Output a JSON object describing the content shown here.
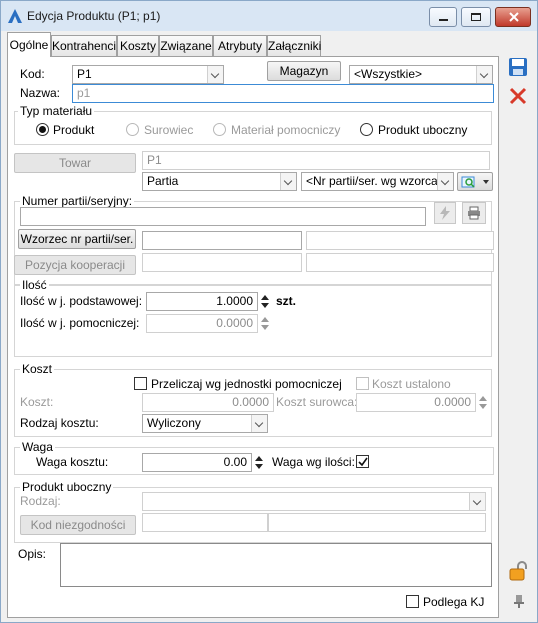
{
  "window": {
    "title": "Edycja Produktu (P1; p1)"
  },
  "tabs": [
    "Ogólne",
    "Kontrahenci",
    "Koszty",
    "Związane",
    "Atrybuty",
    "Załączniki"
  ],
  "general": {
    "kod_label": "Kod:",
    "kod_value": "P1",
    "magazyn_button": "Magazyn",
    "magazyn_value": "<Wszystkie>",
    "nazwa_label": "Nazwa:",
    "nazwa_value": "p1"
  },
  "material_type": {
    "title": "Typ materiału",
    "options": [
      "Produkt",
      "Surowiec",
      "Materiał pomocniczy",
      "Produkt uboczny"
    ],
    "selected": "Produkt"
  },
  "towar": {
    "button": "Towar",
    "value": "P1",
    "partia_value": "Partia",
    "nr_partii_value": "<Nr partii/ser. wg wzorca>"
  },
  "batch": {
    "title": "Numer partii/seryjny:",
    "wzorzec_button": "Wzorzec nr partii/ser.",
    "kooperacja_button": "Pozycja kooperacji"
  },
  "quantity": {
    "title": "Ilość",
    "base_label": "Ilość w j. podstawowej:",
    "base_value": "1.0000",
    "base_unit": "szt.",
    "aux_label": "Ilość w j. pomocniczej:",
    "aux_value": "0.0000"
  },
  "cost": {
    "title": "Koszt",
    "przeliczaj_label": "Przeliczaj wg jednostki pomocniczej",
    "ustalono_label": "Koszt ustalono",
    "koszt_label": "Koszt:",
    "koszt_value": "0.0000",
    "surowca_label": "Koszt surowca:",
    "surowca_value": "0.0000",
    "rodzaj_label": "Rodzaj kosztu:",
    "rodzaj_value": "Wyliczony"
  },
  "weight": {
    "title": "Waga",
    "label": "Waga kosztu:",
    "value": "0.00",
    "wg_ilosci_label": "Waga wg ilości:",
    "wg_ilosci_checked": true
  },
  "byproduct": {
    "title": "Produkt uboczny",
    "rodzaj_label": "Rodzaj:",
    "kod_button": "Kod niezgodności"
  },
  "opis": {
    "label": "Opis:",
    "value": ""
  },
  "footer": {
    "podlega_label": "Podlega KJ"
  },
  "colors": {
    "accent": "#3c8bd6",
    "save": "#2a6fc2",
    "delete": "#d83a2a",
    "title_bg": "#d9e6f4"
  }
}
